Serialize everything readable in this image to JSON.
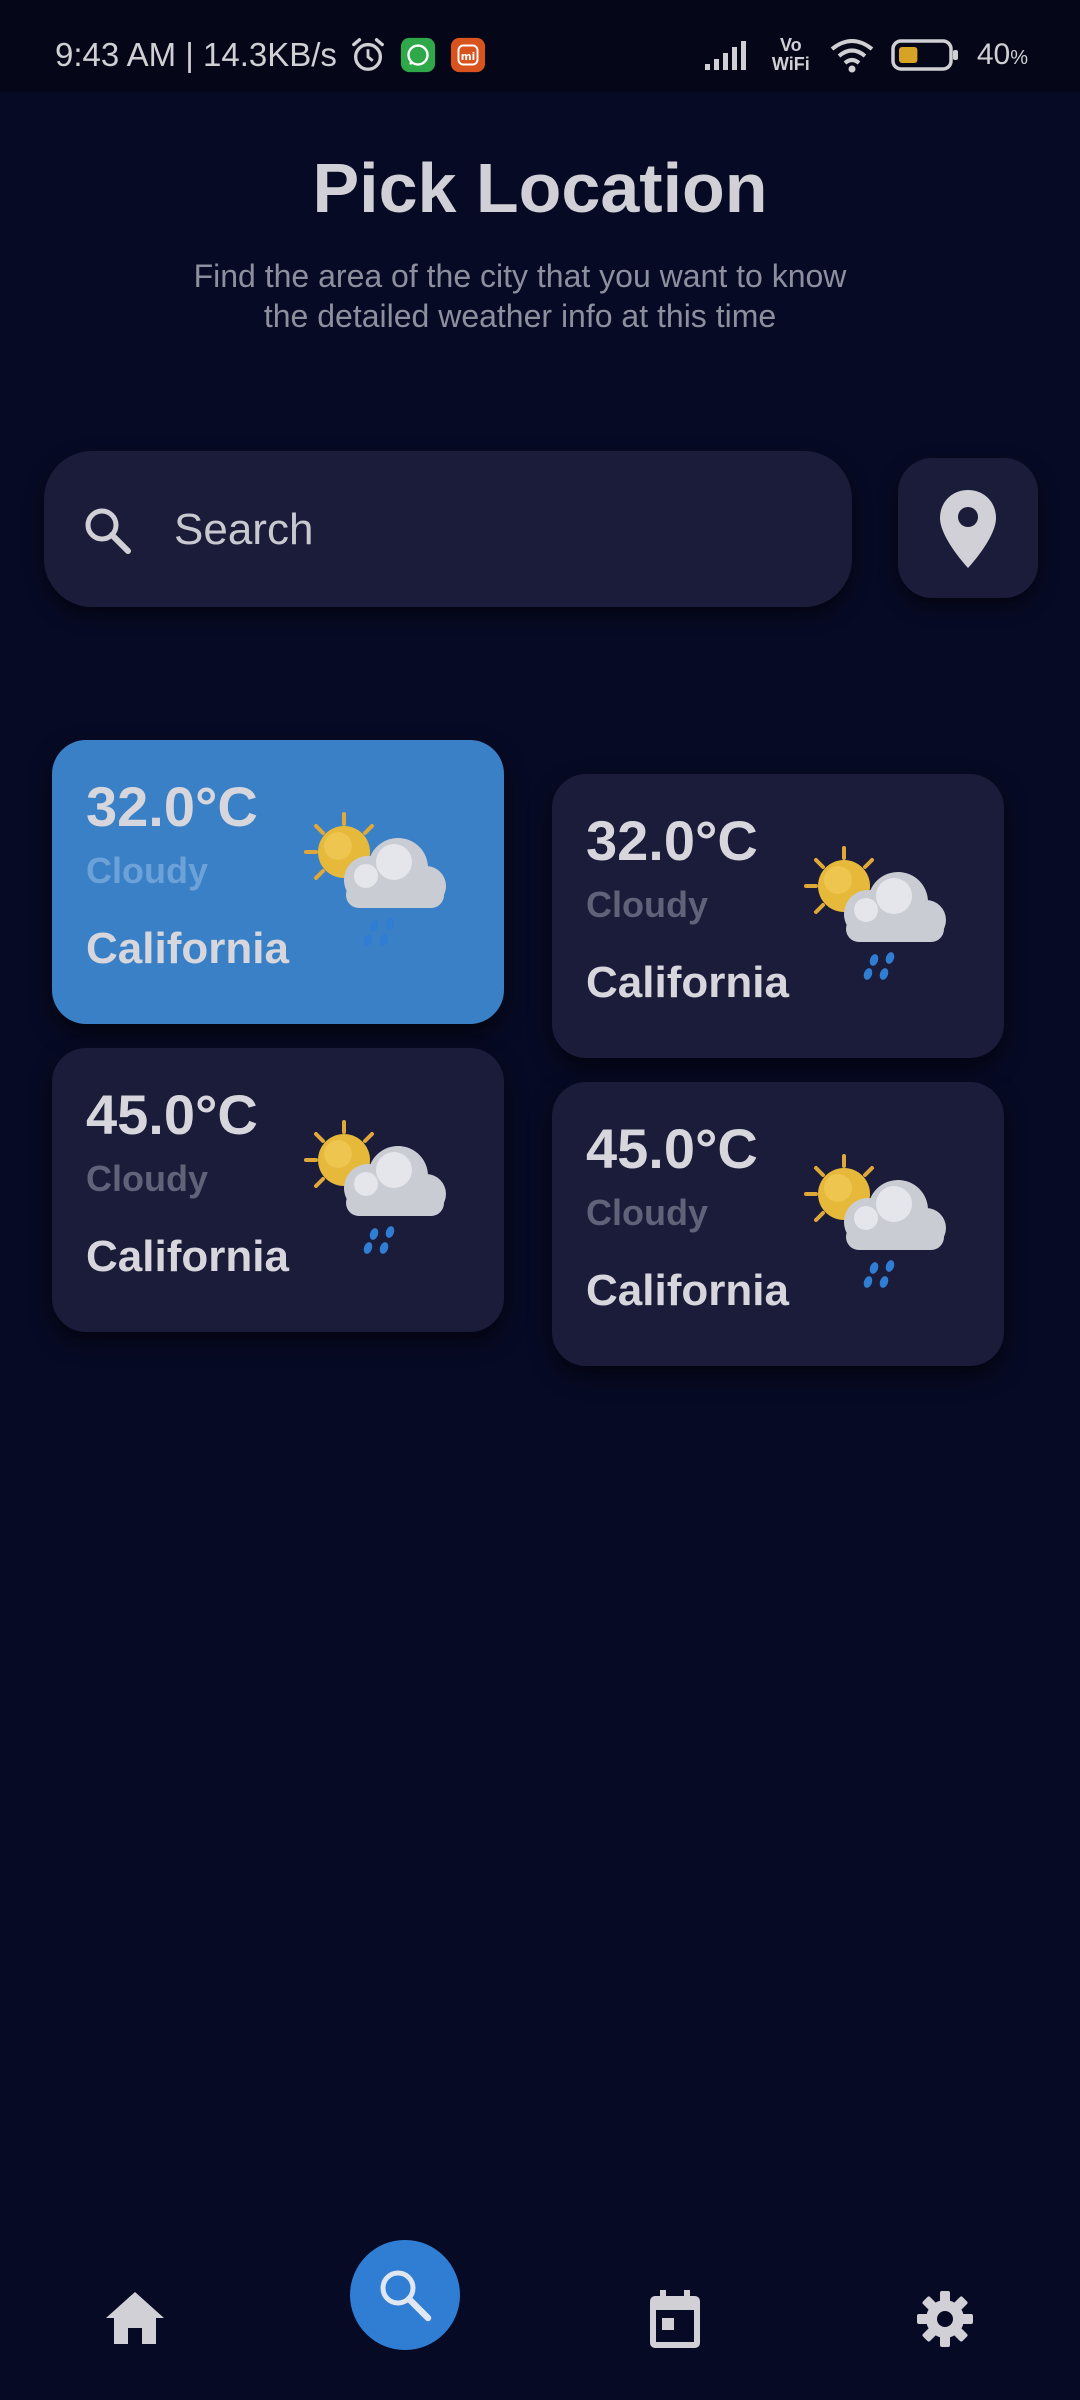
{
  "status_bar": {
    "time": "9:43 AM | 14.3KB/s",
    "network_label": "Vo WiFi",
    "battery_percent": "40",
    "battery_unit": "%",
    "battery_level": 0.4,
    "icons": [
      "alarm-icon",
      "whatsapp-icon",
      "mi-app-icon",
      "signal-icon",
      "vowifi-icon",
      "wifi-icon",
      "battery-icon"
    ]
  },
  "header": {
    "title": "Pick Location",
    "subtitle_line1": "Find the area of the city that you want to know",
    "subtitle_line2": "the detailed weather info at this time"
  },
  "search": {
    "placeholder": "Search",
    "value": ""
  },
  "location_button": {
    "icon": "map-pin-icon"
  },
  "cards": [
    {
      "temp": "32.0°C",
      "condition": "Cloudy",
      "city": "California",
      "selected": true,
      "icon": "partly-cloudy-rain-icon"
    },
    {
      "temp": "32.0°C",
      "condition": "Cloudy",
      "city": "California",
      "selected": false,
      "icon": "partly-cloudy-rain-icon"
    },
    {
      "temp": "45.0°C",
      "condition": "Cloudy",
      "city": "California",
      "selected": false,
      "icon": "partly-cloudy-rain-icon"
    },
    {
      "temp": "45.0°C",
      "condition": "Cloudy",
      "city": "California",
      "selected": false,
      "icon": "partly-cloudy-rain-icon"
    }
  ],
  "bottom_nav": {
    "items": [
      "home-icon",
      "search-icon",
      "calendar-icon",
      "settings-icon"
    ],
    "active": "search-icon"
  },
  "colors": {
    "background": "#070a24",
    "card": "#1a1c39",
    "selected_card": "#3a80c6",
    "accent": "#2f7ed4"
  }
}
